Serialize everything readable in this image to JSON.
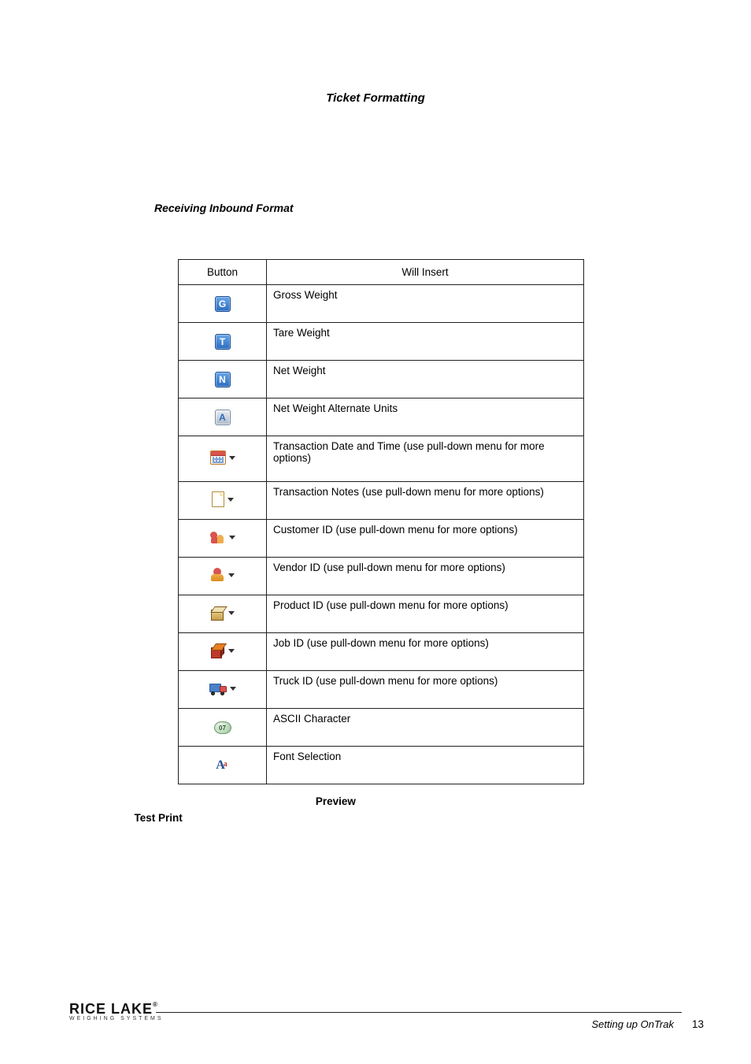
{
  "section_title": "Ticket Formatting",
  "subheading": "Receiving Inbound Format",
  "intro_hidden": "",
  "table": {
    "header_button": "Button",
    "header_insert": "Will Insert",
    "rows": [
      {
        "icon": "G",
        "iconClass": "sq sq-blue",
        "dd": false,
        "desc": "Gross Weight"
      },
      {
        "icon": "T",
        "iconClass": "sq sq-blue",
        "dd": false,
        "desc": "Tare Weight"
      },
      {
        "icon": "N",
        "iconClass": "sq sq-blue",
        "dd": false,
        "desc": "Net Weight"
      },
      {
        "icon": "A",
        "iconClass": "sq sq-gray",
        "dd": false,
        "desc": "Net Weight Alternate Units"
      },
      {
        "icon": "",
        "iconClass": "cal",
        "dd": true,
        "desc": "Transaction Date and Time (use pull-down menu for more options)"
      },
      {
        "icon": "",
        "iconClass": "note",
        "dd": true,
        "desc": "Transaction Notes (use pull-down menu for more options)"
      },
      {
        "icon": "",
        "iconClass": "people",
        "dd": true,
        "desc": "Customer ID (use pull-down menu for more options)"
      },
      {
        "icon": "",
        "iconClass": "vendor",
        "dd": true,
        "desc": "Vendor ID (use pull-down menu for more options)"
      },
      {
        "icon": "",
        "iconClass": "box3d",
        "dd": true,
        "desc": "Product ID (use pull-down menu for more options)"
      },
      {
        "icon": "",
        "iconClass": "cube",
        "dd": true,
        "desc": "Job ID (use pull-down menu for more options)"
      },
      {
        "icon": "",
        "iconClass": "truck",
        "dd": true,
        "desc": "Truck ID (use pull-down menu for more options)"
      },
      {
        "icon": "07",
        "iconClass": "ascii",
        "dd": false,
        "desc": "ASCII Character"
      },
      {
        "icon": "Aa",
        "iconClass": "font-aa",
        "dd": false,
        "desc": "Font Selection"
      }
    ]
  },
  "after": {
    "preview_word": "Preview",
    "testprint_word": "Test Print"
  },
  "footer": {
    "brand_top": "RICE LAKE",
    "brand_sub": "WEIGHING SYSTEMS",
    "doc_section": "Setting up OnTrak",
    "page_no": "13"
  }
}
